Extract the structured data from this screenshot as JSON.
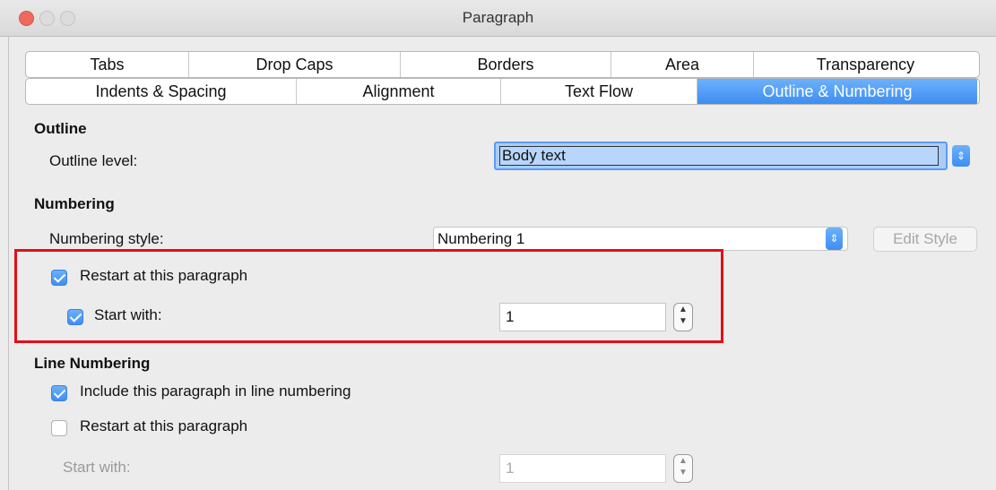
{
  "window": {
    "title": "Paragraph"
  },
  "tabs_row1": [
    {
      "label": "Tabs",
      "w": 182
    },
    {
      "label": "Drop Caps",
      "w": 236
    },
    {
      "label": "Borders",
      "w": 235
    },
    {
      "label": "Area",
      "w": 159
    },
    {
      "label": "Transparency",
      "w": 249
    }
  ],
  "tabs_row2": [
    {
      "label": "Indents & Spacing",
      "w": 302
    },
    {
      "label": "Alignment",
      "w": 228
    },
    {
      "label": "Text Flow",
      "w": 219
    },
    {
      "label": "Outline & Numbering",
      "w": 312,
      "active": true
    }
  ],
  "outline": {
    "heading": "Outline",
    "level_label": "Outline level:",
    "level_value": "Body text"
  },
  "numbering": {
    "heading": "Numbering",
    "style_label": "Numbering style:",
    "style_value": "Numbering 1",
    "edit_style": "Edit Style",
    "restart_label": "Restart at this paragraph",
    "restart_checked": true,
    "start_with_label": "Start with:",
    "start_with_checked": true,
    "start_with_value": "1"
  },
  "line_numbering": {
    "heading": "Line Numbering",
    "include_label": "Include this paragraph in line numbering",
    "include_checked": true,
    "restart_label": "Restart at this paragraph",
    "restart_checked": false,
    "start_with_label": "Start with:",
    "start_with_value": "1"
  },
  "colors": {
    "accent": "#3e8df2",
    "highlight": "#e30f17"
  }
}
